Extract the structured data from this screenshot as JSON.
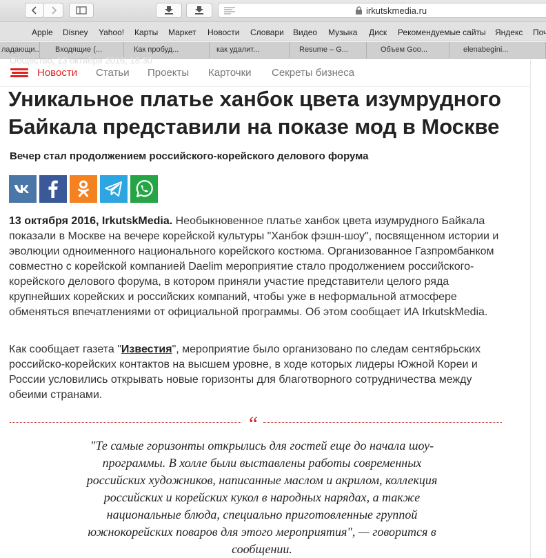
{
  "browser": {
    "url": "irkutskmedia.ru",
    "bookmarks": [
      "Apple",
      "Disney",
      "Yahoo!",
      "Карты",
      "Маркет",
      "Новости",
      "Словари",
      "Видео",
      "Музыка",
      "Диск",
      "Рекомендуемые сайты",
      "Яндекс",
      "Поч"
    ],
    "tabs": [
      "ладающи...",
      "Входящие (...",
      "Как пробуд...",
      "как удалит...",
      "Resume – G...",
      "Объем Goo...",
      "elenabegini..."
    ]
  },
  "site": {
    "ghost_text": "Общество, 13 октября 2016, 18:30",
    "nav": [
      "Новости",
      "Статьи",
      "Проекты",
      "Карточки",
      "Секреты бизнеса"
    ]
  },
  "article": {
    "title": "Уникальное платье ханбок цвета изумрудного Байкала представили на показе мод в Москве",
    "subtitle": "Вечер стал продолжением российского-корейского делового форума",
    "p1_lead": "13 октября 2016, IrkutskMedia.",
    "p1_text": " Необыкновенное платье ханбок цвета изумрудного Байкала показали в Москве на вечере корейской культуры \"Ханбок фэшн-шоу\", посвященном истории и эволюции одноименного национального корейского костюма. Организованное Газпромбанком совместно с корейской компанией Daelim мероприятие стало продолжением российского-корейского делового форума, в котором приняли участие представители целого ряда крупнейших корейских и российских компаний, чтобы уже в неформальной атмосфере обменяться впечатлениями от официальной программы. Об этом сообщает ИА IrkutskMedia.",
    "p2_before": "Как сообщает газета \"",
    "p2_link": "Известия",
    "p2_after": "\", мероприятие было организовано по следам сентябрьских российско-корейских контактов на высшем уровне, в ходе которых лидеры Южной Кореи и России условились открывать новые горизонты для благотворного сотрудничества между обеими странами.",
    "quote_mark": "“",
    "quote": "\"Те самые горизонты открылись для гостей еще до начала шоу-программы. В холле были выставлены работы современных российских художников, написанные маслом и акрилом, коллекция российских и корейских кукол в народных нарядах, а также национальные блюда, специально приготовленные группой южнокорейских поваров для этого мероприятия\", — говорится в сообщении."
  },
  "colors": {
    "accent": "#e02020",
    "vk": "#4a76a8",
    "facebook": "#3b5998",
    "odnoklassniki": "#f58220",
    "telegram": "#2ca5e0",
    "whatsapp": "#25a546"
  }
}
